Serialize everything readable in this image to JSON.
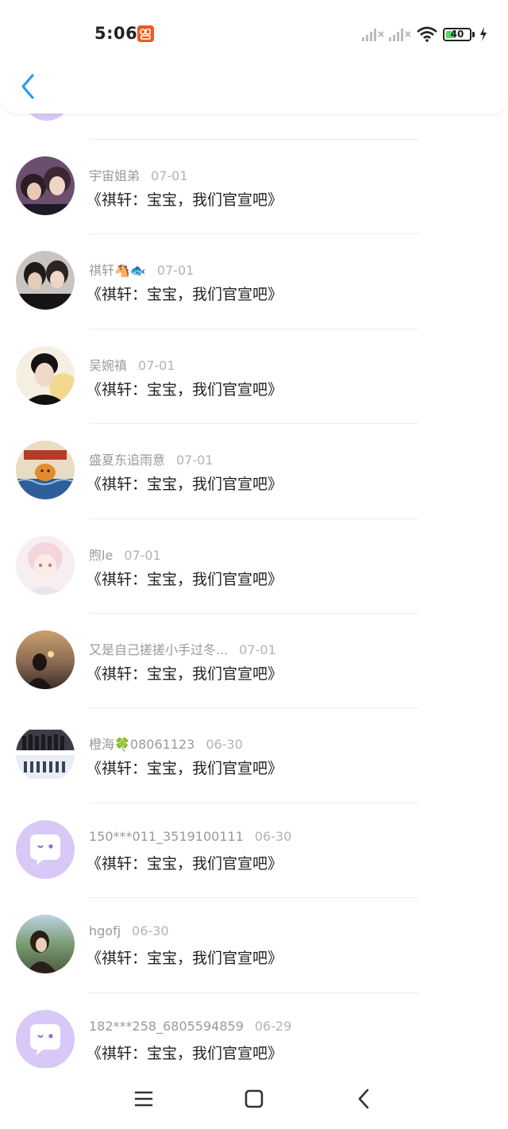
{
  "status_bar": {
    "time": "5:06",
    "battery": "40",
    "battery_level": 0.4,
    "app_badge_icon": "notification-app-icon",
    "accent_color": "#ef5a21"
  },
  "header": {
    "back_icon": "chevron-left-icon",
    "back_color": "#2b9af3"
  },
  "comments": [
    {
      "name": "宇宙姐弟",
      "date": "07-01",
      "text": "《祺轩：宝宝，我们官宣吧》",
      "avatar": "photo-couple"
    },
    {
      "name": "祺轩🐴🐟",
      "date": "07-01",
      "text": "《祺轩：宝宝，我们官宣吧》",
      "avatar": "photo-two-boys"
    },
    {
      "name": "吴婉禛",
      "date": "07-01",
      "text": "《祺轩：宝宝，我们官宣吧》",
      "avatar": "photo-portrait"
    },
    {
      "name": "盛夏东追雨意",
      "date": "07-01",
      "text": "《祺轩：宝宝，我们官宣吧》",
      "avatar": "illustration-tiger"
    },
    {
      "name": "煦le",
      "date": "07-01",
      "text": "《祺轩：宝宝，我们官宣吧》",
      "avatar": "anime-girl"
    },
    {
      "name": "又是自己搓搓小手过冬...",
      "date": "07-01",
      "text": "《祺轩：宝宝，我们官宣吧》",
      "avatar": "sunset-silhouette"
    },
    {
      "name": "橙海🍀08061123",
      "date": "06-30",
      "text": "《祺轩：宝宝，我们官宣吧》",
      "avatar": "group-photo"
    },
    {
      "name": "150***011_3519100111",
      "date": "06-30",
      "text": "《祺轩：宝宝，我们官宣吧》",
      "avatar": "default-chat-avatar"
    },
    {
      "name": "hgofj",
      "date": "06-30",
      "text": "《祺轩：宝宝，我们官宣吧》",
      "avatar": "girl-landscape"
    },
    {
      "name": "182***258_6805594859",
      "date": "06-29",
      "text": "《祺轩：宝宝，我们官宣吧》",
      "avatar": "default-chat-avatar"
    }
  ],
  "navbar": {
    "menu_icon": "menu-icon",
    "home_icon": "home-square-icon",
    "back_icon": "back-triangle-icon"
  }
}
